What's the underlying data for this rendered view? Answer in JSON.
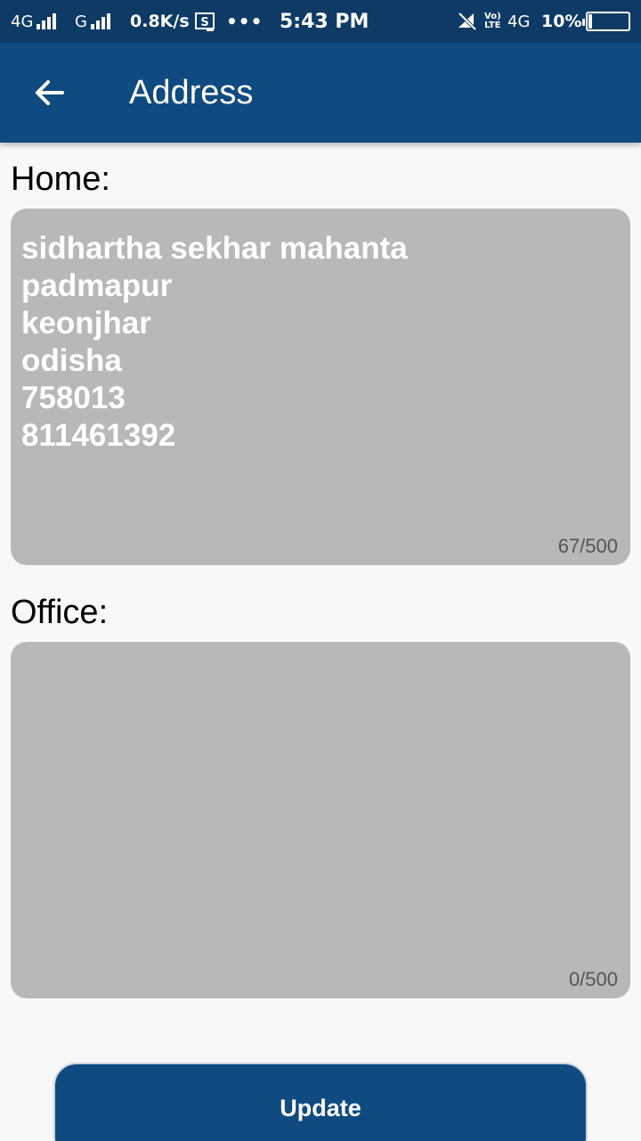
{
  "status_bar": {
    "network1": "4G",
    "network2": "G",
    "speed": "0.8K/s",
    "time": "5:43 PM",
    "volte_top": "Vo)",
    "volte_bottom": "LTE",
    "network3": "4G",
    "battery_percent": "10%",
    "battery_level": 0.1,
    "icons": [
      "signal-icon",
      "screenshot-icon",
      "more-dots-icon",
      "mute-icon",
      "battery-icon"
    ]
  },
  "app_bar": {
    "title": "Address",
    "back_icon": "arrow-left-icon"
  },
  "home": {
    "label": "Home:",
    "value": "sidhartha sekhar mahanta\npadmapur\nkeonjhar\nodisha\n758013\n811461392",
    "counter": "67/500"
  },
  "office": {
    "label": "Office:",
    "value": "",
    "counter": "0/500"
  },
  "update_button": {
    "label": "Update"
  },
  "colors": {
    "status_bar": "#0e3b66",
    "app_bar": "#0f4a80",
    "field_bg": "#b8b8b8",
    "button_bg": "#0f4a80"
  }
}
